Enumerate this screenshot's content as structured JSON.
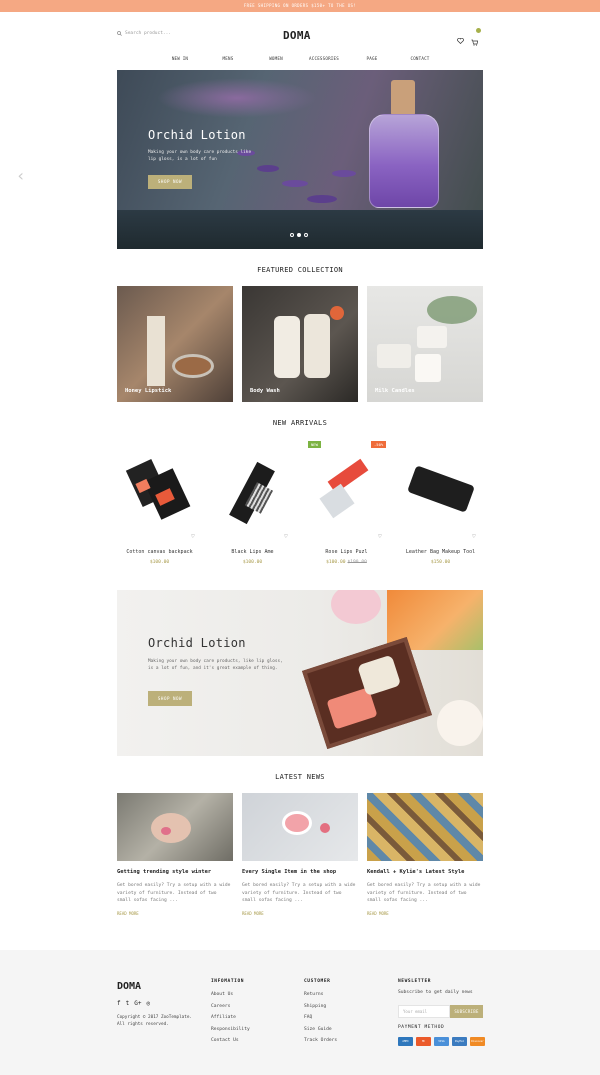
{
  "topbar": {
    "text": "FREE SHIPPING ON ORDERS $150+ TO THE US!"
  },
  "header": {
    "search_placeholder": "Search product...",
    "logo": "DOMA",
    "cart_count": ""
  },
  "nav": [
    "NEW IN",
    "MENS",
    "WOMEN",
    "ACCESSORIES",
    "PAGE",
    "CONTACT"
  ],
  "hero": {
    "title": "Orchid Lotion",
    "text": "Making your own body care products like lip gloss, is a lot of fun",
    "button": "SHOP NOW"
  },
  "featured": {
    "title": "FEATURED COLLECTION",
    "items": [
      {
        "label": "Honey Lipstick"
      },
      {
        "label": "Body Wash"
      },
      {
        "label": "Milk Candles"
      }
    ]
  },
  "arrivals": {
    "title": "NEW ARRIVALS",
    "products": [
      {
        "name": "Cotton canvas backpack",
        "price": "$100.00",
        "old_price": "",
        "badge": ""
      },
      {
        "name": "Black Lips Ame",
        "price": "$100.00",
        "old_price": "",
        "badge": ""
      },
      {
        "name": "Rose Lips Puzl",
        "price": "$100.00",
        "old_price": "$190.00",
        "badge": "NEW"
      },
      {
        "name": "Leather Bag Makeup Tool",
        "price": "$150.00",
        "old_price": "",
        "badge": "-50%"
      }
    ]
  },
  "banner2": {
    "title": "Orchid Lotion",
    "text": "Making your own body care products, like lip gloss, is a lot of fun, and it's great example of thing.",
    "button": "SHOP NOW"
  },
  "news": {
    "title": "LATEST NEWS",
    "items": [
      {
        "title": "Getting trending style winter",
        "excerpt": "Get bored easily? Try a setup with a wide variety of furniture. Instead of two small sofas facing ...",
        "more": "READ MORE"
      },
      {
        "title": "Every Single Item in the shop",
        "excerpt": "Get bored easily? Try a setup with a wide variety of furniture. Instead of two small sofas facing ...",
        "more": "READ MORE"
      },
      {
        "title": "Kendall + Kylie's Latest Style",
        "excerpt": "Get bored easily? Try a setup with a wide variety of furniture. Instead of two small sofas facing ...",
        "more": "READ MORE"
      }
    ]
  },
  "footer": {
    "logo": "DOMA",
    "copyright": "Copyright © 2017 ZooTemplate. All rights reserved.",
    "information": {
      "title": "INFOMATION",
      "links": [
        "About Us",
        "Careers",
        "Affiliate",
        "Responsibility",
        "Contact Us"
      ]
    },
    "customer": {
      "title": "CUSTOMER",
      "links": [
        "Returns",
        "Shipping",
        "FAQ",
        "Size Guide",
        "Track Orders"
      ]
    },
    "newsletter": {
      "title": "NEWSLETTER",
      "subtitle": "Subscribe to get daily news",
      "placeholder": "Your email",
      "button": "SUBSCRIBE"
    },
    "payment": {
      "title": "PAYMENT METHOD",
      "methods": [
        "AMEX",
        "MC",
        "VISA",
        "PayPal",
        "Discover"
      ]
    }
  },
  "colors": {
    "accent": "#bcb07a",
    "topbar": "#f5a883",
    "price": "#a89a4a",
    "badge_new": "#7cb342",
    "badge_sale": "#ef6c3a"
  }
}
